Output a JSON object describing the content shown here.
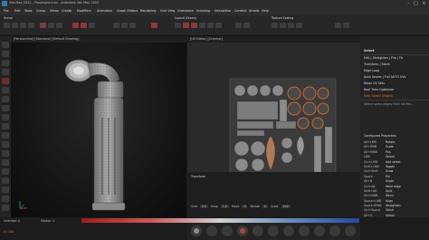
{
  "window": {
    "title": "3ds Max 2022 - Flashlight.max - Autodesk 3ds Max 2022",
    "min": "–",
    "max": "□",
    "close": "×"
  },
  "menu": [
    "File",
    "Edit",
    "Tools",
    "Group",
    "Views",
    "Create",
    "Modifiers",
    "Animation",
    "Graph Editors",
    "Rendering",
    "Civil View",
    "Customize",
    "Scripting",
    "Interactive",
    "Content",
    "Arnold",
    "Help"
  ],
  "panels": {
    "scene_label": "Scene",
    "layout_label": "Layout (Green)",
    "texture_label": "Texture Scaling",
    "viewport1_label": "[Perspective] [Standard] [Default Shading]",
    "viewport2_label": "[UV Editor] [Checker]",
    "transform_label": "Transform"
  },
  "right_panel": {
    "title": "Select",
    "rows": [
      "Edit | Straighten | Flip | Fit",
      "Transform | Stack",
      "Edge Loop",
      "Auto Seams | Full AUTO UVs",
      "Relax UV Sets",
      "Real Time Optimizer",
      "Help Select (Edges)"
    ],
    "desc": "Select some edges then hit this...",
    "table_title": "Configured Properties",
    "table": [
      [
        "Alt+LMB",
        "Rotate"
      ],
      [
        "Alt+RMB",
        "Scale"
      ],
      [
        "Alt+MMB",
        "Pan"
      ],
      [
        "LMB",
        "Select"
      ],
      [
        "Ctrl+LMB",
        "Add select"
      ],
      [
        "Shift+LMB",
        "Toggle"
      ],
      [
        "Ctrl+Shift",
        "Grow"
      ],
      [
        "Space",
        "Pin"
      ],
      [
        "Alt+B",
        "Unpin"
      ],
      [
        "Ctrl+Alt",
        "Weld edge"
      ],
      [
        "Shift+Alt",
        "Split"
      ],
      [
        "Ctrl+RMB",
        "Menu"
      ],
      [
        "Space+LMB",
        "Align"
      ],
      [
        "Space+RMB",
        "Straighten"
      ],
      [
        "Ctrl+Space",
        "Stitch"
      ],
      [
        "Alt+S",
        "Select"
      ],
      [
        "Ctrl+Q",
        "Quit"
      ]
    ]
  },
  "timeline": {
    "label": "Transform",
    "fields": [
      "Grid",
      "Snap",
      "Move",
      "Rotate",
      "Scale"
    ],
    "values": [
      "0.0",
      "1.0",
      "0",
      "0",
      "100"
    ]
  },
  "status": {
    "left": "Selected: 0",
    "mid": "Hidden: 0",
    "right": "Click or click-and-drag to select objects",
    "frame": "0 / 100"
  },
  "colors": {
    "accent": "#e07a2a",
    "ring": "#d0642a",
    "blue_strip": "#204a9b",
    "red_strip": "#9b1b1b"
  },
  "icons": [
    "gear-icon",
    "play-icon",
    "stop-icon",
    "record-icon",
    "key-icon",
    "snap-icon"
  ]
}
